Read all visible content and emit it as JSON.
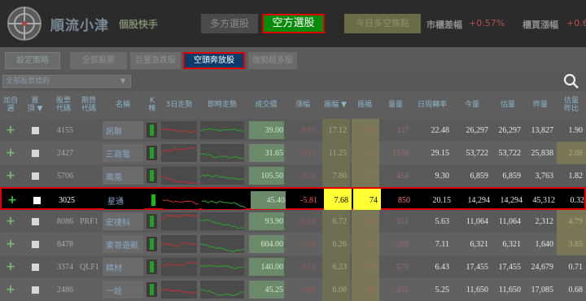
{
  "header": {
    "brand": "順流小津",
    "brand_sub": "個股快手",
    "mode_long_label": "多方選股",
    "mode_short_label": "空方選股",
    "today_btn_label": "今日多空焦點",
    "stat1_label": "市櫃差幅",
    "stat1_value": "+0.57%",
    "stat2_label": "櫃買漲幅",
    "stat2_value": "+0.6"
  },
  "filters": {
    "tabs": [
      "設定策略",
      "全部股票",
      "巨量急跌股",
      "空頭奔放股",
      "強勢超多股"
    ],
    "active_index": 3
  },
  "select": {
    "value": "全部股票標的",
    "arrow": "▼"
  },
  "table": {
    "headers": [
      "加自\n選",
      "置\n頂 ▼",
      "股票\n代碼",
      "期貨\n代碼",
      "名稱",
      "K\n棒",
      "3日走勢",
      "即時走勢",
      "成交價",
      "漲幅",
      "振幅 ▼",
      "振福",
      "量量",
      "日周轉率",
      "今量",
      "估量",
      "昨量",
      "估量\n昨比"
    ],
    "rows": [
      {
        "code": "4155",
        "fut": "",
        "name": "訊聯",
        "price": "39.00",
        "chg": "-9.95",
        "amp": "17.12",
        "amp2": "116",
        "vol": "337",
        "turnover": "22.48",
        "today": "26,297",
        "est": "26,297",
        "yest": "13,827",
        "ratio": "1.90"
      },
      {
        "code": "2427",
        "fut": "",
        "name": "三商電",
        "price": "31.65",
        "chg": "-2.47",
        "amp": "11.25",
        "amp2": "71",
        "vol": "1536",
        "turnover": "29.15",
        "today": "53,722",
        "est": "53,722",
        "yest": "25,838",
        "ratio": "2.08"
      },
      {
        "code": "5706",
        "fut": "",
        "name": "鳳凰",
        "price": "105.50",
        "chg": "-3.21",
        "amp": "7.80",
        "amp2": "17",
        "vol": "454",
        "turnover": "9.30",
        "today": "6,859",
        "est": "6,859",
        "yest": "3,763",
        "ratio": "1.82"
      },
      {
        "code": "3025",
        "fut": "",
        "name": "星通",
        "price": "45.40",
        "chg": "-5.81",
        "amp": "7.68",
        "amp2": "74",
        "vol": "850",
        "turnover": "20.15",
        "today": "14,294",
        "est": "14,294",
        "yest": "45,312",
        "ratio": "0.32"
      },
      {
        "code": "8086",
        "fut": "PRF1",
        "name": "宏捷科",
        "price": "93.90",
        "chg": "-1.68",
        "amp": "6.72",
        "amp2": "62",
        "vol": "551",
        "turnover": "5.63",
        "today": "11,064",
        "est": "11,064",
        "yest": "2,312",
        "ratio": "4.79"
      },
      {
        "code": "8478",
        "fut": "",
        "name": "東哥遊艇",
        "price": "604.00",
        "chg": "-2.26",
        "amp": "6.26",
        "amp2": "37",
        "vol": "289",
        "turnover": "7.11",
        "today": "6,321",
        "est": "6,321",
        "yest": "1,640",
        "ratio": "3.85"
      },
      {
        "code": "3374",
        "fut": "QLF1",
        "name": "精材",
        "price": "140.00",
        "chg": "-3.11",
        "amp": "6.23",
        "amp2": "18",
        "vol": "670",
        "turnover": "6.43",
        "today": "17,455",
        "est": "17,455",
        "yest": "24,679",
        "ratio": "0.71"
      },
      {
        "code": "2486",
        "fut": "",
        "name": "一詮",
        "price": "45.25",
        "chg": "-0.66",
        "amp": "6.08",
        "amp2": "56",
        "vol": "235",
        "turnover": "5.25",
        "today": "11,650",
        "est": "11,650",
        "yest": "17,085",
        "ratio": "0.68"
      }
    ]
  },
  "icons": {
    "logo": "crosshair-logo-icon",
    "search": "search-icon",
    "plus": "plus-icon"
  }
}
